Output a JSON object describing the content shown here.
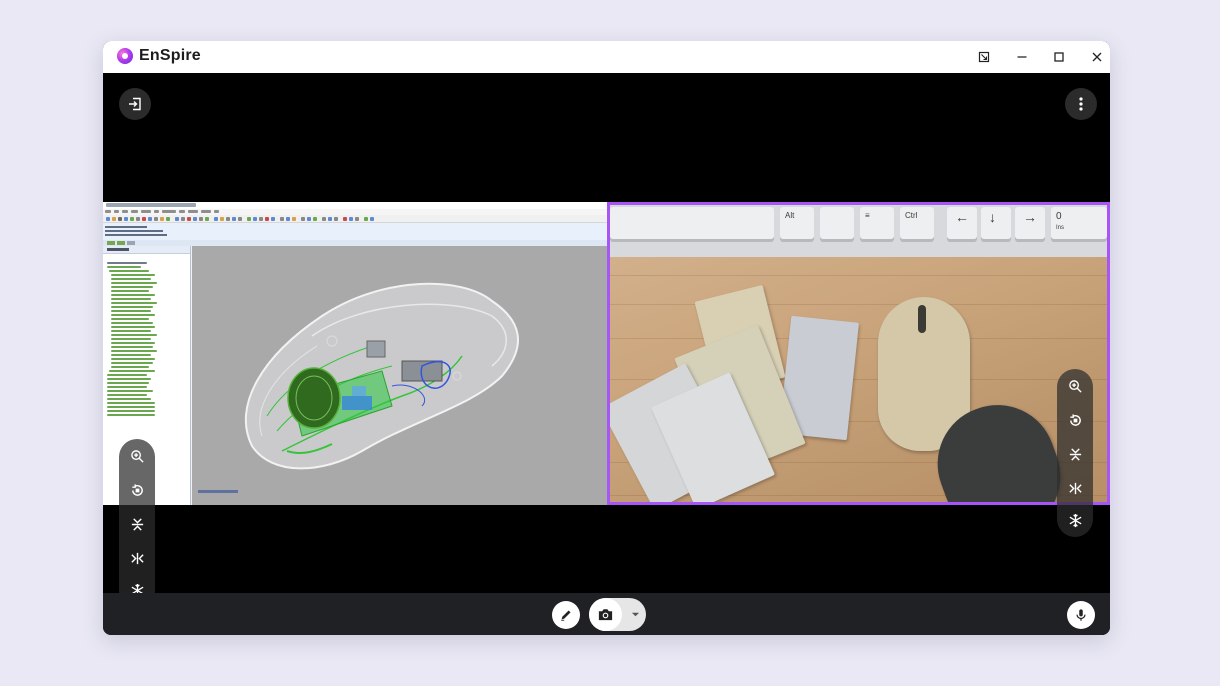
{
  "app": {
    "title": "EnSpire",
    "accent_color": "#a855f7"
  },
  "window_controls": {
    "icons": [
      "resize-icon",
      "minimize-icon",
      "maximize-icon",
      "close-icon"
    ]
  },
  "top_actions": {
    "exit_icon": "exit-icon",
    "more_icon": "more-vertical-icon"
  },
  "left_panel": {
    "content": "cad-software-screen",
    "tools": [
      "zoom-in-icon",
      "rotate-icon",
      "flip-vertical-icon",
      "flip-horizontal-icon",
      "freeze-icon"
    ]
  },
  "right_panel": {
    "content": "camera-feed",
    "selected": true,
    "keyboard_keys": [
      "Alt",
      "",
      "≡",
      "Ctrl",
      "←",
      "↓",
      "→",
      "0",
      "Ins"
    ],
    "tools": [
      "zoom-in-icon",
      "rotate-icon",
      "flip-vertical-icon",
      "flip-horizontal-icon",
      "freeze-icon"
    ]
  },
  "bottom_bar": {
    "pen_icon": "pen-icon",
    "camera_icon": "camera-icon",
    "dropdown_icon": "caret-down-icon",
    "mic_icon": "microphone-icon"
  }
}
